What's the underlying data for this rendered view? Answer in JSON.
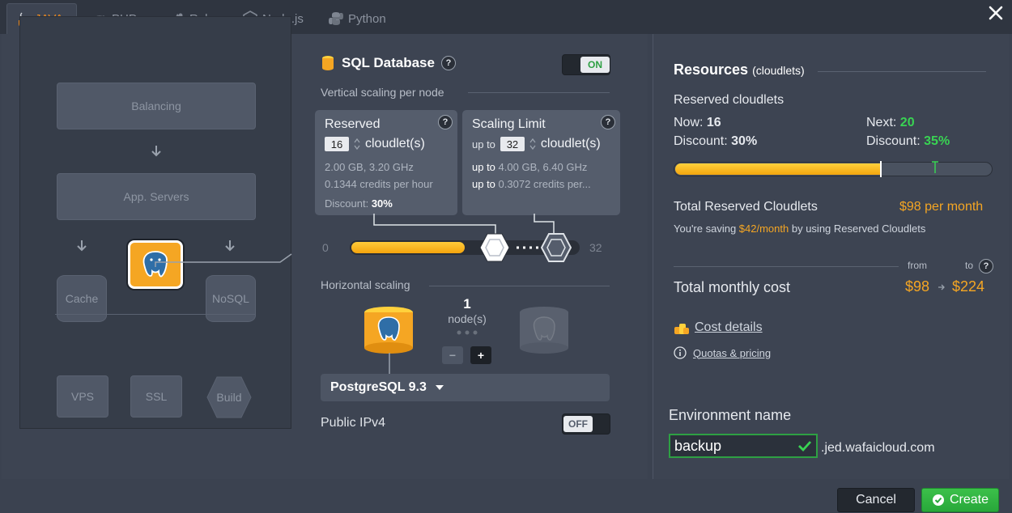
{
  "tabs": [
    {
      "label": "JAVA",
      "icon": "java-icon",
      "active": true
    },
    {
      "label": "PHP",
      "icon": "php-icon"
    },
    {
      "label": "Ruby",
      "icon": "ruby-icon"
    },
    {
      "label": "Node.js",
      "icon": "nodejs-icon"
    },
    {
      "label": "Python",
      "icon": "python-icon"
    }
  ],
  "topology": {
    "balancing": "Balancing",
    "app_servers": "App. Servers",
    "cache": "Cache",
    "nosql": "NoSQL",
    "vps": "VPS",
    "ssl": "SSL",
    "build": "Build"
  },
  "config": {
    "title": "SQL Database",
    "toggle_on": "ON",
    "vertical_label": "Vertical scaling per node",
    "reserved": {
      "title": "Reserved",
      "value": "16",
      "unit": "cloudlet(s)",
      "spec": "2.00 GB, 3.20 GHz",
      "credits": "0.1344 credits per hour",
      "discount_label": "Discount:",
      "discount_value": "30%"
    },
    "scaling": {
      "title": "Scaling Limit",
      "upto": "up to",
      "value": "32",
      "unit": "cloudlet(s)",
      "spec_value": "4.00 GB, 6.40 GHz",
      "credits_value": "0.3072 credits per..."
    },
    "slider_min": "0",
    "slider_max": "32",
    "slider_reserved_fraction": 0.5,
    "horizontal_label": "Horizontal scaling",
    "nodes_count": "1",
    "nodes_label": "node(s)",
    "minus": "−",
    "plus": "+",
    "db_version": "PostgreSQL 9.3",
    "ipv4_label": "Public IPv4",
    "toggle_off": "OFF"
  },
  "resources": {
    "title": "Resources",
    "title_sub": "(cloudlets)",
    "reserved_label": "Reserved cloudlets",
    "now_label": "Now:",
    "now_value": "16",
    "next_label": "Next:",
    "next_value": "20",
    "discount_label": "Discount:",
    "discount_now": "30%",
    "discount_next": "35%",
    "progress_fraction": 0.65,
    "total_reserved_label": "Total Reserved Cloudlets",
    "total_reserved_value": "$98 per month",
    "saving_prefix": "You're saving",
    "saving_value": "$42/month",
    "saving_suffix": "by using Reserved Cloudlets",
    "from_label": "from",
    "to_label": "to",
    "monthly_label": "Total monthly cost",
    "cost_from": "$98",
    "cost_to": "$224",
    "cost_details": "Cost details",
    "quotas": "Quotas & pricing",
    "env_label": "Environment name",
    "env_value": "backup",
    "env_domain": ".jed.wafaicloud.com"
  },
  "footer": {
    "cancel": "Cancel",
    "create": "Create"
  },
  "colors": {
    "accent_orange": "#f5a623",
    "green": "#39d353",
    "bg": "#3b4250"
  }
}
